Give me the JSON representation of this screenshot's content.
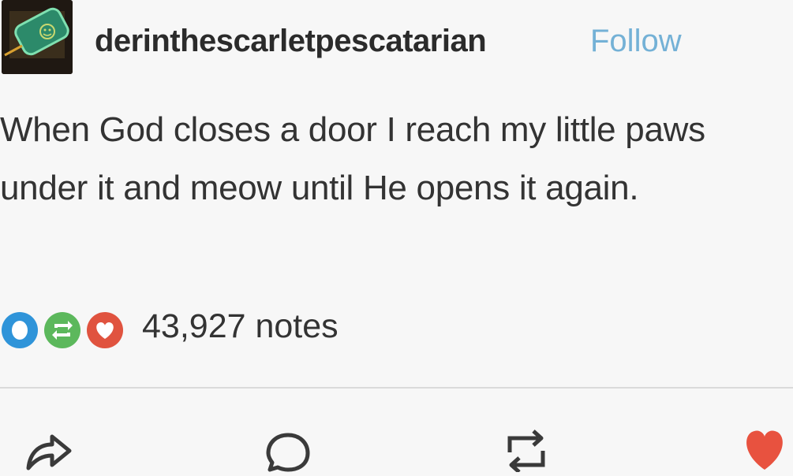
{
  "post": {
    "username": "derinthescarletpescatarian",
    "follow_label": "Follow",
    "body_lines": [
      "When God closes a door I reach my little paws",
      "under it and meow until He opens it again."
    ],
    "notes_label": "43,927 notes"
  },
  "icons": {
    "note_icons": [
      "comment-icon",
      "reblog-icon",
      "heart-icon"
    ],
    "actions": [
      "share-icon",
      "reply-icon",
      "reblog-icon",
      "like-icon"
    ]
  },
  "colors": {
    "follow": "#74b1d6",
    "comment_note": "#2f94d9",
    "reblog_note": "#5cb85c",
    "like_note": "#e0533f",
    "like_action": "#e8523f"
  }
}
